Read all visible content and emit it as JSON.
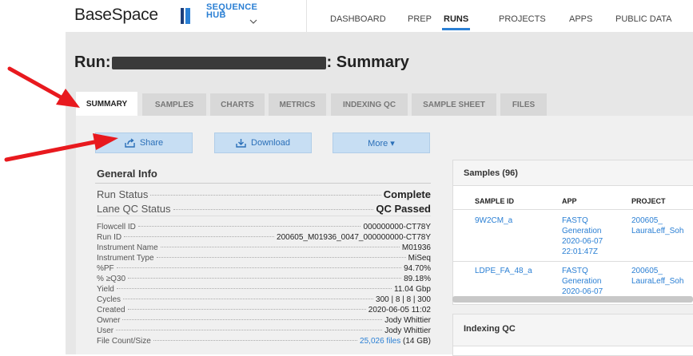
{
  "header": {
    "logo_text": "BaseSpace",
    "hub_line1": "SEQUENCE",
    "hub_line2": "HUB",
    "hub_chevron": "chevron-down-icon",
    "nav": [
      "DASHBOARD",
      "PREP",
      "RUNS",
      "PROJECTS",
      "APPS",
      "PUBLIC DATA"
    ],
    "active_nav": "RUNS",
    "accent": "#2a7fd4"
  },
  "page": {
    "title_prefix": "Run:",
    "title_suffix": ": Summary"
  },
  "tabs": [
    "SUMMARY",
    "SAMPLES",
    "CHARTS",
    "METRICS",
    "INDEXING QC",
    "SAMPLE SHEET",
    "FILES"
  ],
  "active_tab": "SUMMARY",
  "actions": {
    "share": "Share",
    "share_icon": "share-icon",
    "download": "Download",
    "download_icon": "download-icon",
    "more": "More ▾"
  },
  "general_info": {
    "title": "General Info",
    "run_status_label": "Run Status",
    "run_status_value": "Complete",
    "lane_qc_label": "Lane QC Status",
    "lane_qc_value": "QC Passed",
    "rows": [
      {
        "label": "Flowcell ID",
        "value": "000000000-CT78Y"
      },
      {
        "label": "Run ID",
        "value": "200605_M01936_0047_000000000-CT78Y"
      },
      {
        "label": "Instrument Name",
        "value": "M01936"
      },
      {
        "label": "Instrument Type",
        "value": "MiSeq"
      },
      {
        "label": "%PF",
        "value": "94.70%"
      },
      {
        "label": "% ≥Q30",
        "value": "89.18%"
      },
      {
        "label": "Yield",
        "value": "11.04 Gbp"
      },
      {
        "label": "Cycles",
        "value": "300 | 8 | 8 | 300"
      },
      {
        "label": "Created",
        "value": "2020-06-05 11:02"
      },
      {
        "label": "Owner",
        "value": "Jody Whittier"
      },
      {
        "label": "User",
        "value": "Jody Whittier"
      }
    ],
    "file_count_label": "File Count/Size",
    "file_count_link": "25,026 files",
    "file_count_size": "(14 GB)"
  },
  "samples_panel": {
    "title": "Samples (96)",
    "columns": [
      "SAMPLE ID",
      "APP",
      "PROJECT"
    ],
    "rows": [
      {
        "id": "9W2CM_a",
        "app": [
          "FASTQ",
          "Generation",
          "2020-06-07",
          "22:01:47Z"
        ],
        "project": [
          "200605_",
          "LauraLeff_Soh"
        ]
      },
      {
        "id": "LDPE_FA_48_a",
        "app": [
          "FASTQ",
          "Generation",
          "2020-06-07"
        ],
        "project": [
          "200605_",
          "LauraLeff_Soh"
        ]
      }
    ]
  },
  "indexing_panel": {
    "title": "Indexing QC"
  },
  "annotation_color": "#e8191e"
}
